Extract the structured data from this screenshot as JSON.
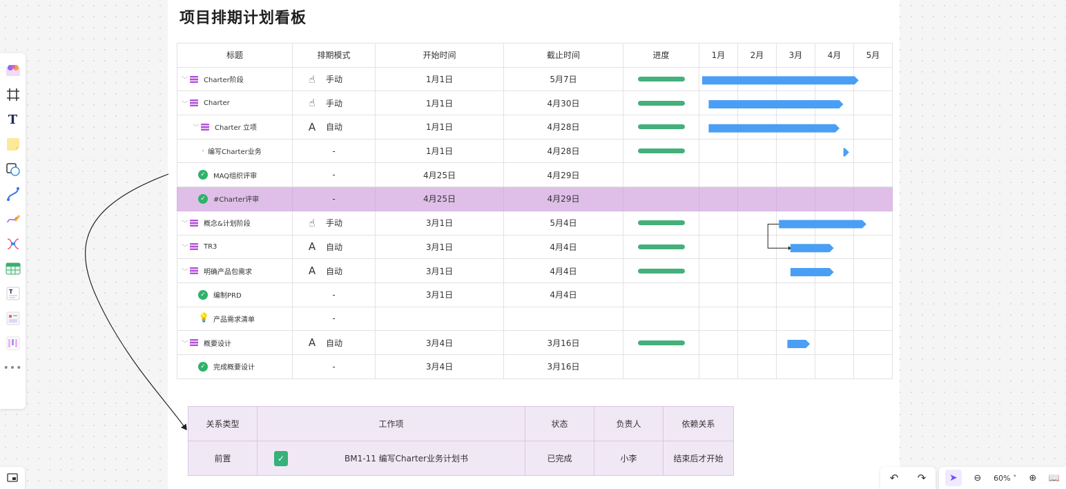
{
  "board": {
    "title": "项目排期计划看板"
  },
  "gantt": {
    "headers": {
      "title": "标题",
      "mode": "排期模式",
      "start": "开始时间",
      "end": "截止时间",
      "progress": "进度",
      "months": [
        "1月",
        "2月",
        "3月",
        "4月",
        "5月"
      ]
    },
    "rows": [
      {
        "chev": "﹀",
        "icon": "task",
        "title": "Charter阶段",
        "mode_icon": "hand",
        "mode": "手动",
        "start": "1月1日",
        "end": "5月7日",
        "progress": 1,
        "bar": [
          0.0,
          4.15
        ]
      },
      {
        "chev": "﹀",
        "icon": "task",
        "title": "Charter",
        "mode_icon": "hand",
        "mode": "手动",
        "start": "1月1日",
        "end": "4月30日",
        "progress": 1,
        "bar": [
          0.17,
          3.75
        ]
      },
      {
        "chev": "﹀",
        "icon": "task",
        "title": "Charter 立项",
        "mode_icon": "auto",
        "mode": "自动",
        "start": "1月1日",
        "end": "4月28日",
        "progress": 1,
        "bar": [
          0.17,
          3.65
        ]
      },
      {
        "chev": "›",
        "icon": "none",
        "title": "编写Charter业务",
        "mode_icon": "none",
        "mode": "-",
        "start": "1月1日",
        "end": "4月28日",
        "progress": 1,
        "bar": [
          3.68,
          3.9
        ]
      },
      {
        "chev": "",
        "icon": "check",
        "title": "MAQ组织评审",
        "mode_icon": "none",
        "mode": "-",
        "start": "4月25日",
        "end": "4月29日",
        "progress": 0,
        "bar": null
      },
      {
        "chev": "",
        "icon": "check",
        "title": "#Charter评审",
        "mode_icon": "none",
        "mode": "-",
        "start": "4月25日",
        "end": "4月29日",
        "progress": 0,
        "bar": null,
        "highlight": true
      },
      {
        "chev": "﹀",
        "icon": "task",
        "title": "概念&计划阶段",
        "mode_icon": "hand",
        "mode": "手动",
        "start": "3月1日",
        "end": "5月4日",
        "progress": 1,
        "bar": [
          2.0,
          4.35
        ]
      },
      {
        "chev": "﹀",
        "icon": "task",
        "title": "TR3",
        "mode_icon": "auto",
        "mode": "自动",
        "start": "3月1日",
        "end": "4月4日",
        "progress": 1,
        "bar": [
          2.3,
          3.5
        ]
      },
      {
        "chev": "﹀",
        "icon": "task",
        "title": "明确产品包需求",
        "mode_icon": "auto",
        "mode": "自动",
        "start": "3月1日",
        "end": "4月4日",
        "progress": 1,
        "bar": [
          2.3,
          3.5
        ]
      },
      {
        "chev": "",
        "icon": "check",
        "title": "编制PRD",
        "mode_icon": "none",
        "mode": "-",
        "start": "3月1日",
        "end": "4月4日",
        "progress": 0,
        "bar": null
      },
      {
        "chev": "",
        "icon": "bulb",
        "title": "产品需求清单",
        "mode_icon": "none",
        "mode": "-",
        "start": "",
        "end": "",
        "progress": 0,
        "bar": null
      },
      {
        "chev": "﹀",
        "icon": "task",
        "title": "概要设计",
        "mode_icon": "auto",
        "mode": "自动",
        "start": "3月4日",
        "end": "3月16日",
        "progress": 1,
        "bar": [
          2.22,
          2.88
        ]
      },
      {
        "chev": "",
        "icon": "check",
        "title": "完成概要设计",
        "mode_icon": "none",
        "mode": "-",
        "start": "3月4日",
        "end": "3月16日",
        "progress": 0,
        "bar": null
      }
    ]
  },
  "relation": {
    "headers": {
      "type": "关系类型",
      "item": "工作项",
      "status": "状态",
      "owner": "负责人",
      "dep": "依赖关系"
    },
    "row": {
      "type": "前置",
      "item": "BM1-11 编写Charter业务计划书",
      "status": "已完成",
      "owner": "小李",
      "dep": "结束后才开始"
    }
  },
  "toolbar": {
    "tools": [
      "template-icon",
      "frame-icon",
      "text-icon",
      "sticky-note-icon",
      "shape-icon",
      "connector-icon",
      "pen-icon",
      "mindmap-icon",
      "table-icon",
      "text-card-icon",
      "kanban-icon",
      "gantt-icon",
      "more-icon"
    ]
  },
  "zoom": {
    "level": "60%",
    "caret": "˅"
  },
  "colors": {
    "bar": "#4a9ff5",
    "progress": "#44b07a",
    "highlight": "#dfbfe8",
    "relation_bg": "#f1e8f6"
  }
}
